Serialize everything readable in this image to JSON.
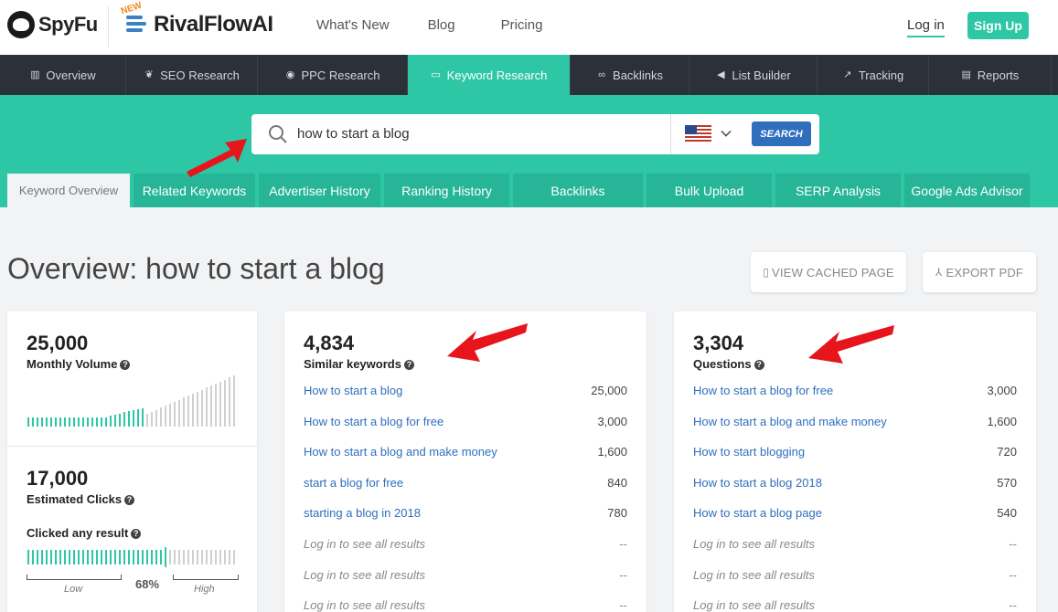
{
  "header": {
    "logo_text": "SpyFu",
    "rival_badge": "NEW",
    "rival_text": "RivalFlowAI",
    "nav": [
      "What's New",
      "Blog",
      "Pricing"
    ],
    "login": "Log in",
    "signup": "Sign Up"
  },
  "main_nav": [
    {
      "label": "Overview",
      "icon": "bar-chart-icon"
    },
    {
      "label": "SEO Research",
      "icon": "leaf-icon"
    },
    {
      "label": "PPC Research",
      "icon": "target-icon"
    },
    {
      "label": "Keyword Research",
      "icon": "keyboard-icon",
      "active": true
    },
    {
      "label": "Backlinks",
      "icon": "link-icon"
    },
    {
      "label": "List Builder",
      "icon": "megaphone-icon"
    },
    {
      "label": "Tracking",
      "icon": "line-chart-icon"
    },
    {
      "label": "Reports",
      "icon": "file-icon"
    }
  ],
  "search": {
    "query": "how to start a blog",
    "country": "US",
    "button": "SEARCH"
  },
  "sub_tabs": [
    "Keyword Overview",
    "Related Keywords",
    "Advertiser History",
    "Ranking History",
    "Backlinks",
    "Bulk Upload",
    "SERP Analysis",
    "Google Ads Advisor"
  ],
  "page": {
    "title": "Overview: how to start a blog",
    "view_cached": "VIEW CACHED PAGE",
    "export_pdf": "EXPORT PDF"
  },
  "volume_card": {
    "monthly_volume": "25,000",
    "monthly_volume_label": "Monthly Volume",
    "clicks": "17,000",
    "clicks_label": "Estimated Clicks",
    "clicked_label": "Clicked any result",
    "clicked_pct": "68%",
    "clicked_fraction": 0.68,
    "low": "Low",
    "high": "High",
    "accent": "#2dc7a5"
  },
  "similar_card": {
    "count": "4,834",
    "label": "Similar keywords",
    "rows": [
      {
        "k": "How to start a blog",
        "v": "25,000"
      },
      {
        "k": "How to start a blog for free",
        "v": "3,000"
      },
      {
        "k": "How to start a blog and make money",
        "v": "1,600"
      },
      {
        "k": "start a blog for free",
        "v": "840"
      },
      {
        "k": "starting a blog in 2018",
        "v": "780"
      },
      {
        "k": "Log in to see all results",
        "v": "--",
        "locked": true
      },
      {
        "k": "Log in to see all results",
        "v": "--",
        "locked": true
      },
      {
        "k": "Log in to see all results",
        "v": "--",
        "locked": true
      }
    ]
  },
  "questions_card": {
    "count": "3,304",
    "label": "Questions",
    "rows": [
      {
        "k": "How to start a blog for free",
        "v": "3,000"
      },
      {
        "k": "How to start a blog and make money",
        "v": "1,600"
      },
      {
        "k": "How to start blogging",
        "v": "720"
      },
      {
        "k": "How to start a blog 2018",
        "v": "570"
      },
      {
        "k": "How to start a blog page",
        "v": "540"
      },
      {
        "k": "Log in to see all results",
        "v": "--",
        "locked": true
      },
      {
        "k": "Log in to see all results",
        "v": "--",
        "locked": true
      },
      {
        "k": "Log in to see all results",
        "v": "--",
        "locked": true
      }
    ]
  }
}
